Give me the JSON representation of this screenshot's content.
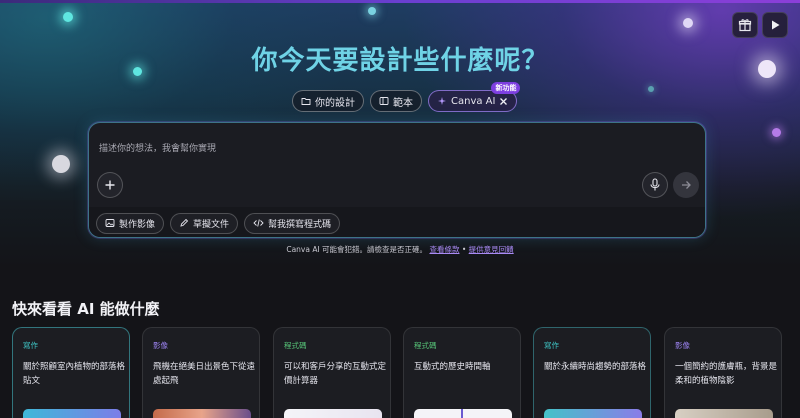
{
  "hero": {
    "title": "你今天要設計些什麼呢？",
    "gift_icon": "gift-icon",
    "play_icon": "play-icon"
  },
  "chips": [
    {
      "label": "你的設計",
      "icon": "folder-icon"
    },
    {
      "label": "範本",
      "icon": "template-icon"
    },
    {
      "label": "Canva AI",
      "icon": "sparkle-icon",
      "badge": "新功能",
      "active": true
    }
  ],
  "prompt": {
    "placeholder": "描述你的想法，我會幫你實現",
    "tools": [
      {
        "label": "製作影像",
        "icon": "image-icon"
      },
      {
        "label": "草擬文件",
        "icon": "pen-icon"
      },
      {
        "label": "幫我撰寫程式碼",
        "icon": "code-icon"
      }
    ]
  },
  "disclaimer": {
    "text": "Canva AI 可能會犯錯。請檢查是否正確。",
    "link1": "查看條款",
    "separator": "•",
    "link2": "提供意見回饋"
  },
  "section": {
    "title": "快來看看 AI 能做什麼",
    "cards": [
      {
        "tag": "寫作",
        "text": "關於照顧室內植物的部落格貼文",
        "tag_color": "#3fc8c8",
        "thumb": "linear-gradient(90deg,#3fb8d8,#7b7de8)"
      },
      {
        "tag": "影像",
        "text": "飛機在絕美日出景色下從遠處起飛",
        "tag_color": "#9b82f0",
        "thumb": "linear-gradient(90deg,#c46a4a,#e8a48a,#6a4e8a)"
      },
      {
        "tag": "程式碼",
        "text": "可以和客戶分享的互動式定價計算器",
        "tag_color": "#58c87a",
        "thumb": "linear-gradient(90deg,#f4f4f8,#e8e4f0)"
      },
      {
        "tag": "程式碼",
        "text": "互動式的歷史時間軸",
        "tag_color": "#58c87a",
        "thumb": "linear-gradient(90deg,#f4f4f8 0%,#f4f4f8 48%,#6a5ad0 48%,#6a5ad0 50%,#f4f4f8 50%)"
      },
      {
        "tag": "寫作",
        "text": "關於永續時尚趨勢的部落格",
        "tag_color": "#3fc8c8",
        "thumb": "linear-gradient(90deg,#44c2c8,#8a7ce8)"
      },
      {
        "tag": "影像",
        "text": "一個簡約的護膚瓶，背景是柔和的植物陰影",
        "tag_color": "#9b82f0",
        "thumb": "linear-gradient(90deg,#d8d0c4,#a89c8c)"
      }
    ]
  }
}
